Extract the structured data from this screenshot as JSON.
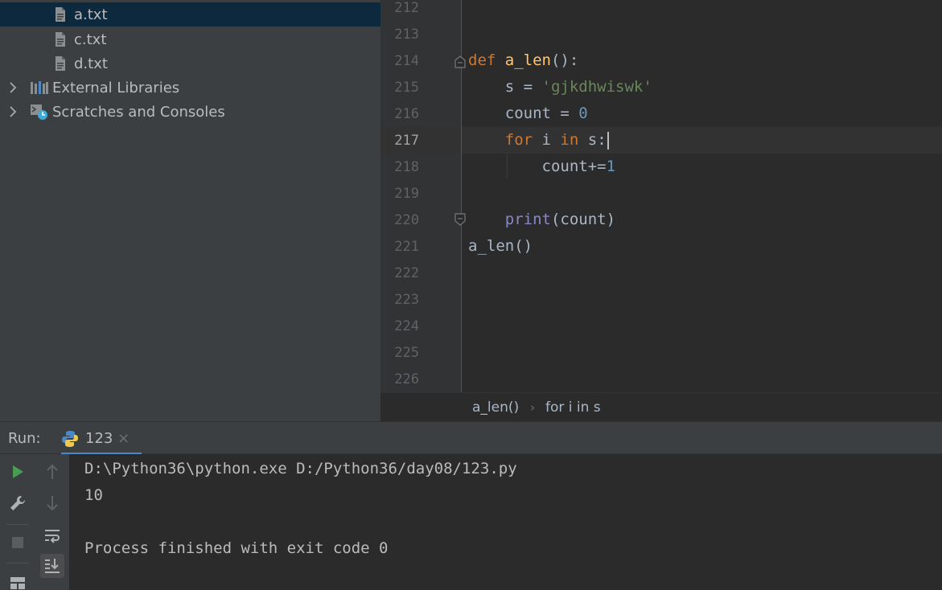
{
  "project_tree": {
    "items": [
      {
        "label": "a.txt",
        "type": "file",
        "selected": true
      },
      {
        "label": "c.txt",
        "type": "file",
        "selected": false
      },
      {
        "label": "d.txt",
        "type": "file",
        "selected": false
      },
      {
        "label": "External Libraries",
        "type": "library",
        "selected": false
      },
      {
        "label": "Scratches and Consoles",
        "type": "scratches",
        "selected": false
      }
    ]
  },
  "editor": {
    "line_numbers": [
      "212",
      "213",
      "214",
      "215",
      "216",
      "217",
      "218",
      "219",
      "220",
      "221",
      "222",
      "223",
      "224",
      "225",
      "226"
    ],
    "active_line": "217",
    "code": {
      "l214_kw": "def",
      "l214_fn": "a_len",
      "l214_rest": "():",
      "l215_pre": "    s = ",
      "l215_str": "'gjkdhwiswk'",
      "l216_pre": "    count = ",
      "l216_num": "0",
      "l217_kw1": "for",
      "l217_mid": " i ",
      "l217_kw2": "in",
      "l217_rest": " s:",
      "l218_pre": "        count+=",
      "l218_num": "1",
      "l220_builtin": "print",
      "l220_rest": "(count)",
      "l221": "a_len()"
    }
  },
  "breadcrumb": {
    "items": [
      "a_len()",
      "for i in s"
    ],
    "separator": "›"
  },
  "run_panel": {
    "label": "Run:",
    "tab_label": "123",
    "tab_close": "×",
    "output": [
      "D:\\Python36\\python.exe D:/Python36/day08/123.py",
      "10",
      "",
      "Process finished with exit code 0"
    ]
  },
  "colors": {
    "keyword": "#cc7832",
    "function": "#ffc66d",
    "string": "#6a8759",
    "number": "#6897bb",
    "builtin": "#8888c6",
    "run_green": "#499c54",
    "selection": "#0d293e"
  }
}
